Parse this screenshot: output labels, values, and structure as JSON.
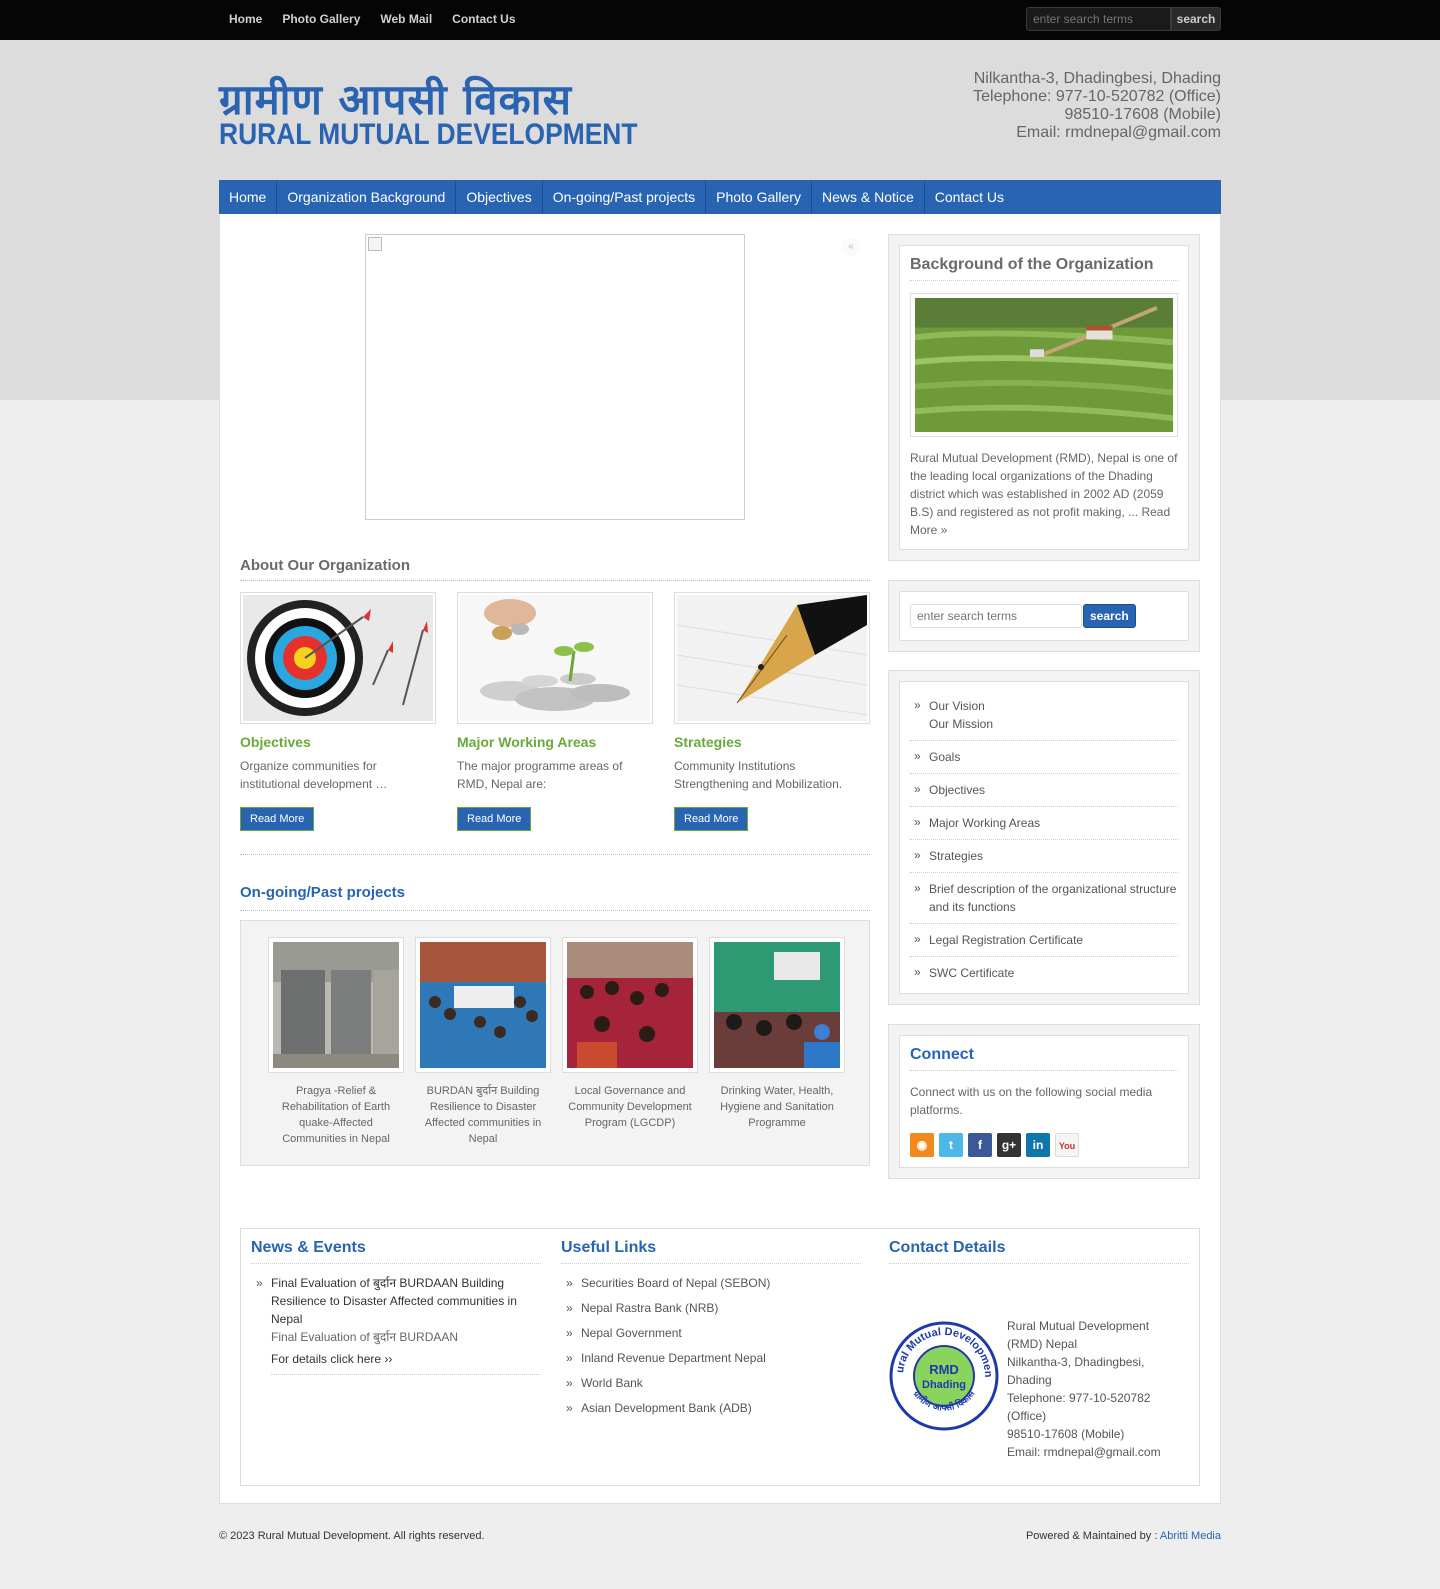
{
  "topbar": {
    "nav": [
      "Home",
      "Photo Gallery",
      "Web Mail",
      "Contact Us"
    ],
    "search_placeholder": "enter search terms",
    "search_label": "search"
  },
  "header": {
    "logo_np": "ग्रामीण आपसी विकास",
    "logo_en": "RURAL MUTUAL DEVELOPMENT",
    "address": [
      "Nilkantha-3, Dhadingbesi, Dhading",
      "Telephone: 977-10-520782 (Office)",
      "98510-17608 (Mobile)",
      "Email: rmdnepal@gmail.com"
    ]
  },
  "mainnav": [
    "Home",
    "Organization Background",
    "Objectives",
    "On-going/Past projects",
    "Photo Gallery",
    "News & Notice",
    "Contact Us"
  ],
  "slider": {
    "arrow": "«"
  },
  "about": {
    "title": "About Our Organization",
    "cards": [
      {
        "title": "Objectives",
        "text": "Organize communities for institutional development …",
        "button": "Read More"
      },
      {
        "title": "Major Working Areas",
        "text": "The major programme areas of RMD, Nepal are:",
        "button": "Read More"
      },
      {
        "title": "Strategies",
        "text": "Community Institutions Strengthening and Mobilization.",
        "button": "Read More"
      }
    ]
  },
  "projects": {
    "title": "On-going/Past projects",
    "items": [
      "Pragya -Relief & Rehabilitation of Earth quake-Affected Communities in Nepal",
      "BURDAN बुर्दान Building Resilience to Disaster Affected communities in Nepal",
      "Local Governance and Community Development Program (LGCDP)",
      "Drinking Water, Health, Hygiene and Sanitation Programme"
    ]
  },
  "sidebar": {
    "background": {
      "title": "Background of the Organization",
      "text": "Rural Mutual Development (RMD), Nepal is one of the leading local organizations of the Dhading district which was established in 2002 AD (2059 B.S) and registered as not profit making, ... Read More »"
    },
    "search": {
      "placeholder": "enter search terms",
      "button": "search"
    },
    "links": [
      {
        "label": "Our Vision",
        "sub": "Our Mission"
      },
      {
        "label": "Goals"
      },
      {
        "label": "Objectives"
      },
      {
        "label": "Major Working Areas"
      },
      {
        "label": "Strategies"
      },
      {
        "label": "Brief description of the organizational structure and its functions"
      },
      {
        "label": "Legal Registration Certificate"
      },
      {
        "label": "SWC Certificate"
      }
    ],
    "connect": {
      "title": "Connect",
      "text": "Connect with us on the following social media platforms."
    }
  },
  "footer": {
    "news": {
      "title": "News & Events",
      "item_title": "Final Evaluation of बुर्दान BURDAAN Building Resilience to Disaster Affected communities in Nepal",
      "item_desc": "Final Evaluation of बुर्दान BURDAAN",
      "item_link": "For details click here ››"
    },
    "links": {
      "title": "Useful Links",
      "items": [
        "Securities Board of Nepal (SEBON)",
        "Nepal Rastra Bank (NRB)",
        "Nepal Government",
        "Inland Revenue Department Nepal",
        "World Bank",
        "Asian Development Bank (ADB)"
      ]
    },
    "contact": {
      "title": "Contact Details",
      "seal_top": "Rural Mutual Development",
      "seal_mid": "RMD",
      "seal_mid2": "Dhading",
      "seal_bottom": "ग्रामीण आपसी विकास",
      "lines": [
        "Rural Mutual Development (RMD) Nepal",
        "Nilkantha-3, Dhadingbesi, Dhading",
        "Telephone: 977-10-520782 (Office)",
        "98510-17608 (Mobile)",
        "Email: rmdnepal@gmail.com"
      ]
    },
    "copyright": "© 2023 Rural Mutual Development. All rights reserved.",
    "powered_label": "Powered & Maintained by :",
    "powered_by": "Abritti Media"
  },
  "colors": {
    "brand_blue": "#2864b1",
    "accent_green": "#6ba83a",
    "topbar": "#050505"
  }
}
